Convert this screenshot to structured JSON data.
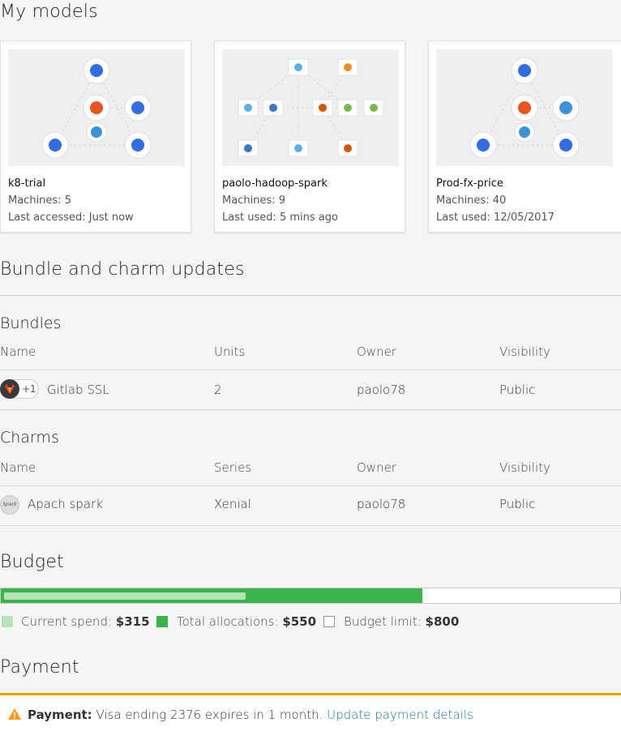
{
  "models": {
    "title": "My models",
    "cards": [
      {
        "name": "k8-trial",
        "machines": "Machines: 5",
        "last": "Last accessed: Just now"
      },
      {
        "name": "paolo-hadoop-spark",
        "machines": "Machines: 9",
        "last": "Last used: 5 mins ago"
      },
      {
        "name": "Prod-fx-price",
        "machines": "Machines: 40",
        "last": "Last used: 12/05/2017"
      }
    ]
  },
  "updates": {
    "title": "Bundle and charm updates",
    "bundles": {
      "title": "Bundles",
      "headers": [
        "Name",
        "Units",
        "Owner",
        "Visibility"
      ],
      "rows": [
        {
          "icon": "gitlab-icon",
          "badge": "+1",
          "name": "Gitlab SSL",
          "units": "2",
          "owner": "paolo78",
          "visibility": "Public"
        }
      ]
    },
    "charms": {
      "title": "Charms",
      "headers": [
        "Name",
        "Series",
        "Owner",
        "Visibility"
      ],
      "rows": [
        {
          "icon": "spark-icon",
          "icon_text": "Spark",
          "name": "Apach spark",
          "series": "Xenial",
          "owner": "paolo78",
          "visibility": "Public"
        }
      ]
    }
  },
  "budget": {
    "title": "Budget",
    "current_spend_fraction": 0.39,
    "allocations_fraction": 0.68,
    "legend": {
      "current_label": "Current spend: ",
      "current_value": "$315",
      "alloc_label": "Total allocations: ",
      "alloc_value": "$550",
      "limit_label": "Budget limit: ",
      "limit_value": "$800"
    },
    "colors": {
      "current": "#b8e3b8",
      "allocations": "#38b44a",
      "limit": "#ffffff"
    }
  },
  "payment": {
    "title": "Payment",
    "alert_label": "Payment:",
    "alert_text": " Visa ending 2376 expires in 1 month. ",
    "link_text": "Update payment details",
    "accent": "#f99b11"
  }
}
